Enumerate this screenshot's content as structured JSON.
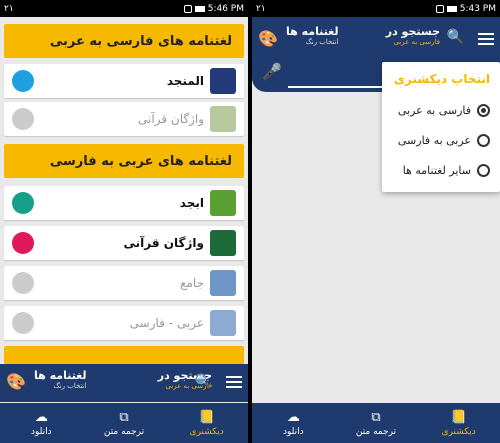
{
  "left": {
    "status": {
      "carrier": "۲۱",
      "time": "5:46 PM"
    },
    "sections": [
      {
        "title": "لغتنامه های فارسی به عربی"
      },
      {
        "title": "لغتنامه های عربی به فارسی"
      }
    ],
    "rows": [
      {
        "name": "المنجد",
        "style": "bold",
        "color": "#1ea0e0",
        "icon_label": "المنجد",
        "icon_bg": "#223a7a"
      },
      {
        "name": "واژگان قرآنی",
        "style": "muted",
        "color": "#cccccc",
        "icon_label": "واژگان",
        "icon_bg": "#b8c9a0"
      },
      {
        "name": "ابجد",
        "style": "bold",
        "color": "#17a089",
        "icon_label": "ابجد",
        "icon_bg": "#5aa032"
      },
      {
        "name": "واژگان قرآنی",
        "style": "bold",
        "color": "#e0195a",
        "icon_label": "واژگان",
        "icon_bg": "#1e6b3a"
      },
      {
        "name": "جامع",
        "style": "muted",
        "color": "#cccccc",
        "icon_label": "جامع",
        "icon_bg": "#6e96c8"
      },
      {
        "name": "عربی - فارسی",
        "style": "muted",
        "color": "#cccccc",
        "icon_label": "عربی به فارسی",
        "icon_bg": "#8caad2"
      }
    ],
    "appbar": {
      "search_title": "جستجو در",
      "search_sub": "فارسی به عربی",
      "dict_title": "لغتنامه ها",
      "dict_sub": "انتخاب رنگ"
    },
    "nav": [
      {
        "label": "دانلود",
        "icon": "download-icon"
      },
      {
        "label": "ترجمه متن",
        "icon": "translate-icon"
      },
      {
        "label": "دیکشنری",
        "icon": "dictionary-icon",
        "active": true
      }
    ]
  },
  "right": {
    "status": {
      "carrier": "۲۱",
      "time": "5:43 PM"
    },
    "appbar": {
      "search_title": "جستجو در",
      "search_sub": "فارسی به عربی",
      "dict_title": "لغتنامه ها",
      "dict_sub": "انتخاب رنگ"
    },
    "popup": {
      "title": "انتخاب دیکشنری",
      "options": [
        {
          "label": "فارسی به عربی",
          "checked": true
        },
        {
          "label": "عربی به فارسی",
          "checked": false
        },
        {
          "label": "سایر لغتنامه ها",
          "checked": false
        }
      ]
    },
    "nav": [
      {
        "label": "دانلود",
        "icon": "download-icon"
      },
      {
        "label": "ترجمه متن",
        "icon": "translate-icon"
      },
      {
        "label": "دیکشنری",
        "icon": "dictionary-icon",
        "active": true
      }
    ]
  },
  "colors": {
    "accent": "#f7b800",
    "primary": "#1f3a6e"
  }
}
